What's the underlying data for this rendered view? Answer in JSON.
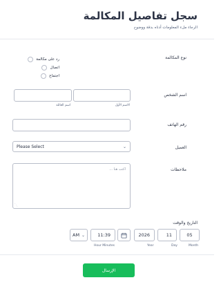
{
  "header": {
    "title": "سجل تفاصيل المكالمة",
    "subtitle": "الرجاء ملء المعلومات أدناه بدقة ووضوح"
  },
  "call_type": {
    "label": "نوع المكالمة",
    "options": [
      "رد على مكالمة",
      "اتصال",
      "اجتماع"
    ]
  },
  "person_name": {
    "label": "اسم الشخص",
    "first_sublabel": "الاسم الأول",
    "last_sublabel": "اسم العائلة",
    "first_value": "",
    "last_value": ""
  },
  "phone": {
    "label": "رقم الهاتف",
    "value": ""
  },
  "client": {
    "label": "العميل",
    "selected": "Please Select"
  },
  "notes": {
    "label": "ملاحظات",
    "placeholder": "اكتب هنا ..."
  },
  "datetime": {
    "label": "التاريخ والوقت",
    "month": "05",
    "day": "11",
    "year": "2026",
    "time": "11:39",
    "ampm": "AM",
    "month_label": "Month",
    "day_label": "Day",
    "year_label": "Year",
    "time_label": "Hour Minutes"
  },
  "submit": {
    "label": "الإرسال"
  },
  "colors": {
    "submit": "#18bd5b",
    "text": "#2c3345",
    "border": "#b8bdc9"
  }
}
